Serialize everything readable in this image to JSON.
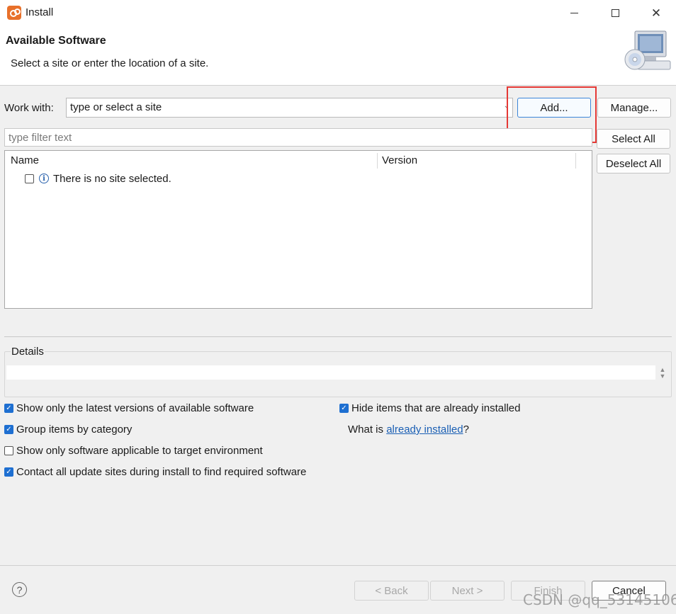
{
  "window": {
    "title": "Install",
    "app_icon": "eclipse-install-icon"
  },
  "banner": {
    "title": "Available Software",
    "description": "Select a site or enter the location of a site.",
    "image": "computer-cd-icon"
  },
  "work_with": {
    "label": "Work with:",
    "value": "type or select a site",
    "add_label": "Add...",
    "manage_label": "Manage..."
  },
  "filter": {
    "placeholder": "type filter text"
  },
  "side_buttons": {
    "select_all": "Select All",
    "deselect_all": "Deselect All"
  },
  "table": {
    "columns": [
      "Name",
      "Version"
    ],
    "rows": [
      {
        "name": "There is no site selected.",
        "checked": false,
        "icon": "info-icon"
      }
    ]
  },
  "details": {
    "label": "Details",
    "value": ""
  },
  "options": {
    "show_latest": {
      "label": "Show only the latest versions of available software",
      "checked": true
    },
    "group_by_category": {
      "label": "Group items by category",
      "checked": true
    },
    "show_applicable": {
      "label": "Show only software applicable to target environment",
      "checked": false
    },
    "contact_sites": {
      "label": "Contact all update sites during install to find required software",
      "checked": true
    },
    "hide_installed": {
      "label": "Hide items that are already installed",
      "checked": true
    },
    "what_is_prefix": "What is",
    "what_is_link": "already installed",
    "what_is_suffix": "?"
  },
  "footer": {
    "back": "< Back",
    "next": "Next >",
    "finish": "Finish",
    "cancel": "Cancel"
  },
  "watermark": "CSDN @qq_53145106",
  "colors": {
    "highlight": "#e53935",
    "accent": "#1e6fd1",
    "link": "#1a5fb4"
  }
}
